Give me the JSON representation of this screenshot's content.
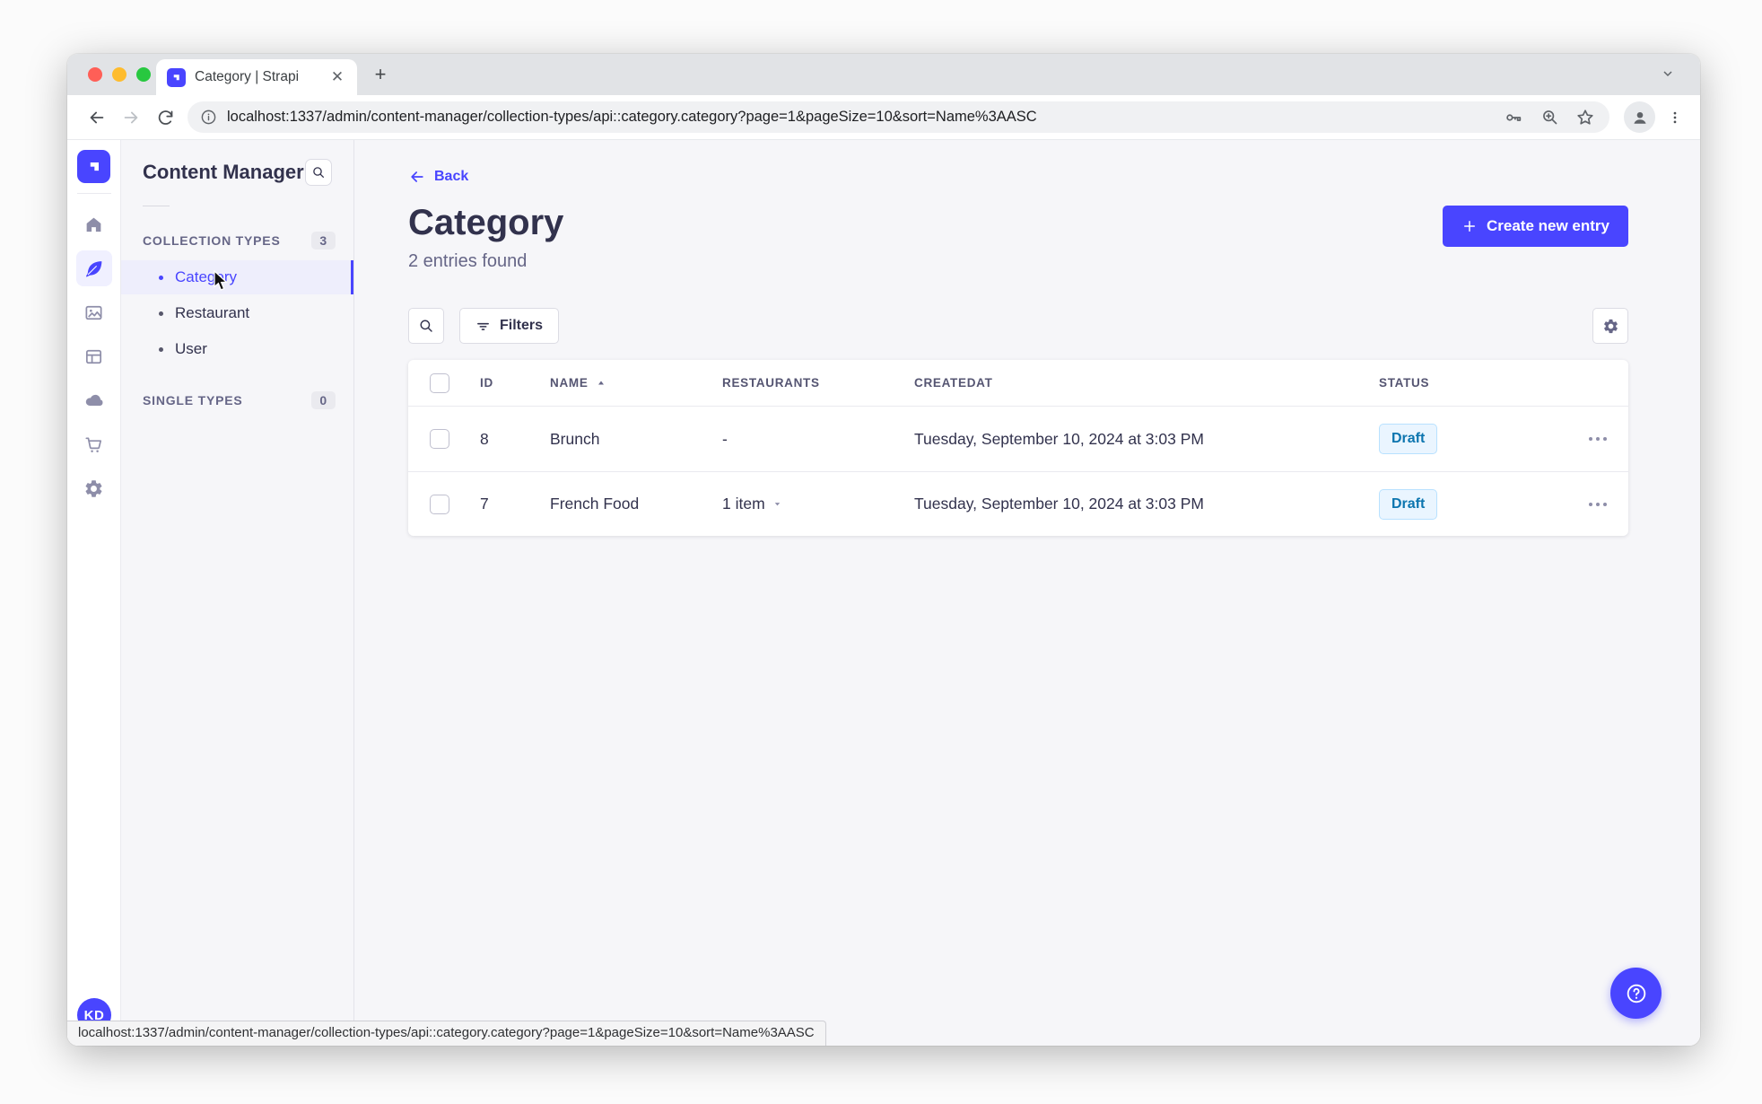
{
  "browser": {
    "tab_title": "Category | Strapi",
    "url": "localhost:1337/admin/content-manager/collection-types/api::category.category?page=1&pageSize=10&sort=Name%3AASC",
    "status_url": "localhost:1337/admin/content-manager/collection-types/api::category.category?page=1&pageSize=10&sort=Name%3AASC"
  },
  "nav_rail": {
    "user_initials": "KD"
  },
  "subnav": {
    "title": "Content Manager",
    "collection_types_label": "COLLECTION TYPES",
    "collection_types_count": "3",
    "items": [
      {
        "label": "Category"
      },
      {
        "label": "Restaurant"
      },
      {
        "label": "User"
      }
    ],
    "single_types_label": "SINGLE TYPES",
    "single_types_count": "0"
  },
  "main": {
    "back_label": "Back",
    "title": "Category",
    "subtitle": "2 entries found",
    "create_button_label": "Create new entry",
    "filters_button_label": "Filters"
  },
  "table": {
    "headers": {
      "id": "ID",
      "name": "NAME",
      "restaurants": "RESTAURANTS",
      "createdat": "CREATEDAT",
      "status": "STATUS"
    },
    "rows": [
      {
        "id": "8",
        "name": "Brunch",
        "restaurants": "-",
        "createdat": "Tuesday, September 10, 2024 at 3:03 PM",
        "status": "Draft"
      },
      {
        "id": "7",
        "name": "French Food",
        "restaurants": "1 item",
        "createdat": "Tuesday, September 10, 2024 at 3:03 PM",
        "status": "Draft"
      }
    ]
  },
  "colors": {
    "accent": "#4945ff",
    "active_item_bg": "#eeeefc",
    "draft_badge_bg": "#eaf5ff",
    "draft_badge_border": "#b8e1ff",
    "draft_badge_text": "#0c75af"
  }
}
